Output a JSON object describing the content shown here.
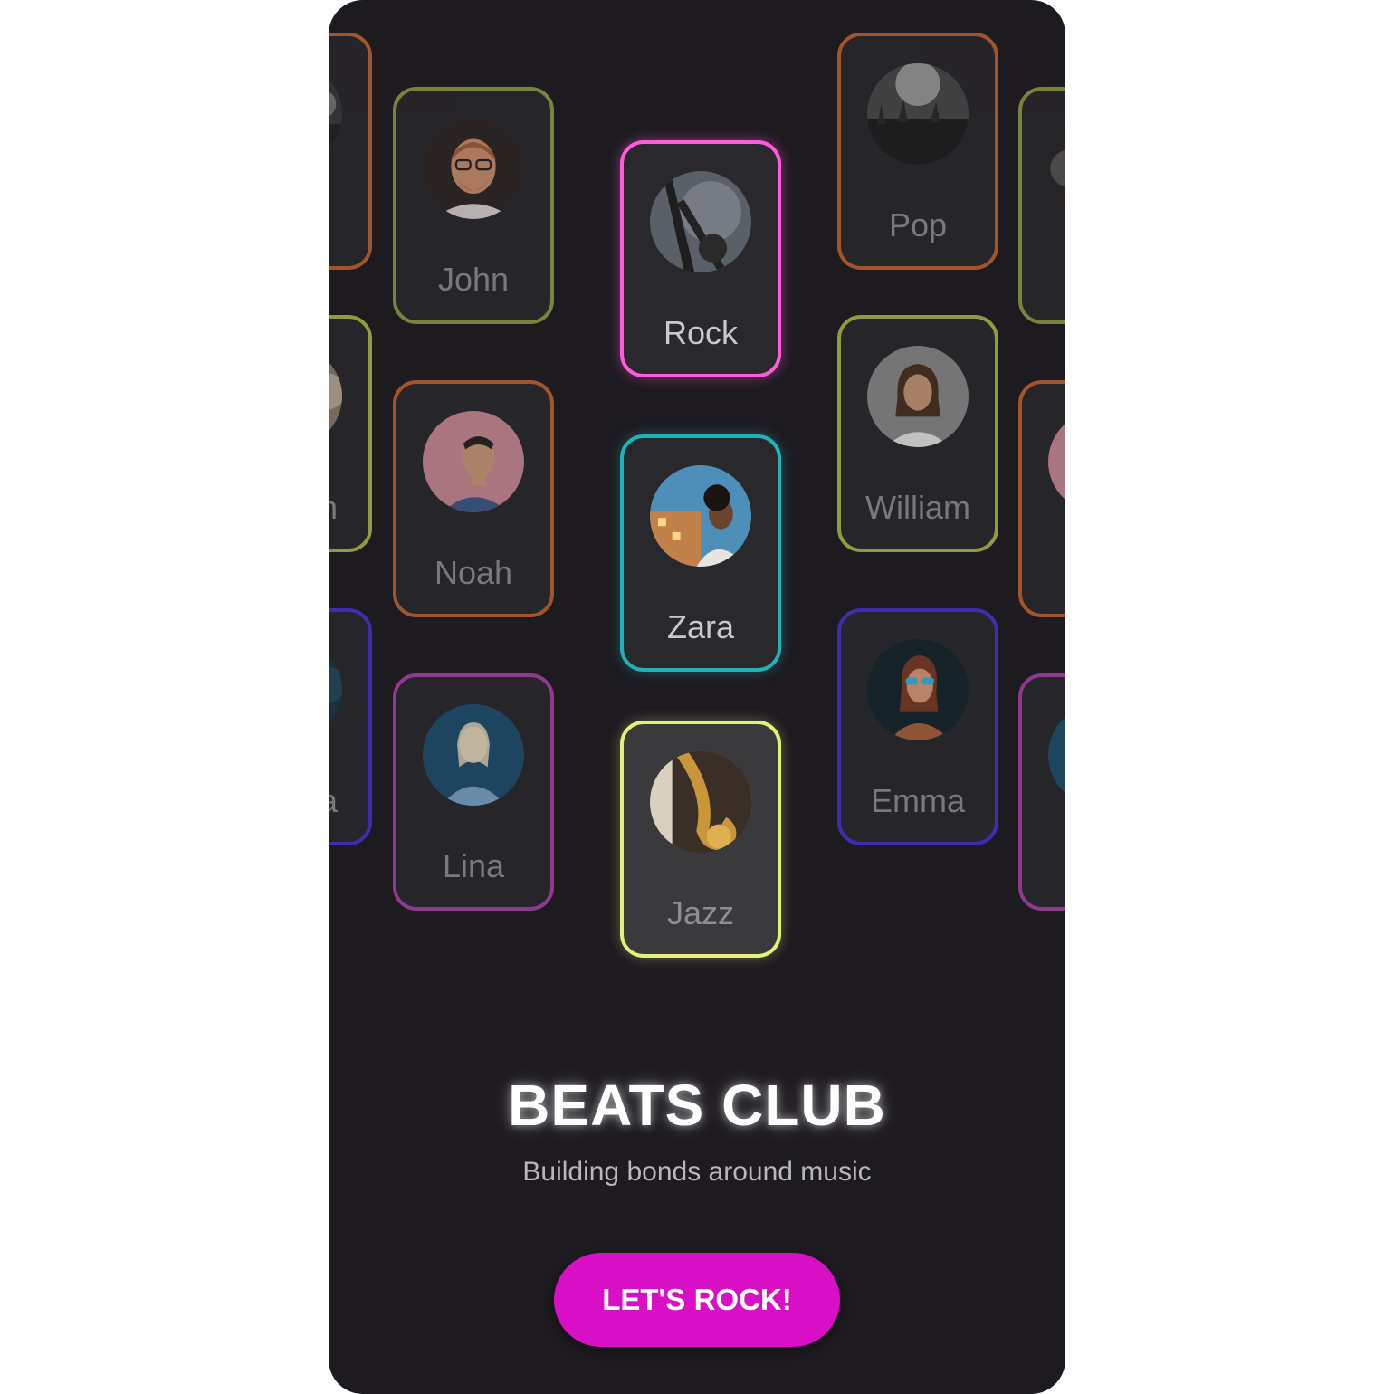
{
  "app": {
    "title": "BEATS CLUB",
    "subtitle": "Building bonds around music",
    "cta_label": "LET'S ROCK!",
    "cta_color": "#d90fc6",
    "background_color": "#1d1a20"
  },
  "cards": {
    "edge_left_1": {
      "label": "",
      "border": "#c0632e",
      "avatar": "concert-crowd-photo"
    },
    "edge_left_2": {
      "label": "n",
      "border": "#a9b843",
      "avatar": "person-photo"
    },
    "edge_left_3": {
      "label": "a",
      "border": "#4a2fd0",
      "avatar": "person-photo"
    },
    "john": {
      "label": "John",
      "border": "#8f9a44",
      "avatar": "john-photo"
    },
    "noah": {
      "label": "Noah",
      "border": "#c0632e",
      "avatar": "noah-photo"
    },
    "lina": {
      "label": "Lina",
      "border": "#a940a8",
      "avatar": "lina-photo"
    },
    "rock": {
      "label": "Rock",
      "border": "#ff5ad9",
      "avatar": "guitar-photo"
    },
    "zara": {
      "label": "Zara",
      "border": "#1fb3b8",
      "avatar": "zara-photo"
    },
    "jazz": {
      "label": "Jazz",
      "border": "#e3f07a",
      "avatar": "saxophone-photo"
    },
    "pop": {
      "label": "Pop",
      "border": "#c0632e",
      "avatar": "concert-crowd-photo"
    },
    "william": {
      "label": "William",
      "border": "#a9b843",
      "avatar": "william-photo"
    },
    "emma": {
      "label": "Emma",
      "border": "#4a2fd0",
      "avatar": "emma-photo"
    },
    "edge_right_1": {
      "label": "",
      "border": "#8f9a44",
      "avatar": "person-photo"
    },
    "edge_right_2": {
      "label": "",
      "border": "#c0632e",
      "avatar": "person-photo"
    },
    "edge_right_3": {
      "label": "",
      "border": "#a940a8",
      "avatar": "person-photo"
    }
  }
}
